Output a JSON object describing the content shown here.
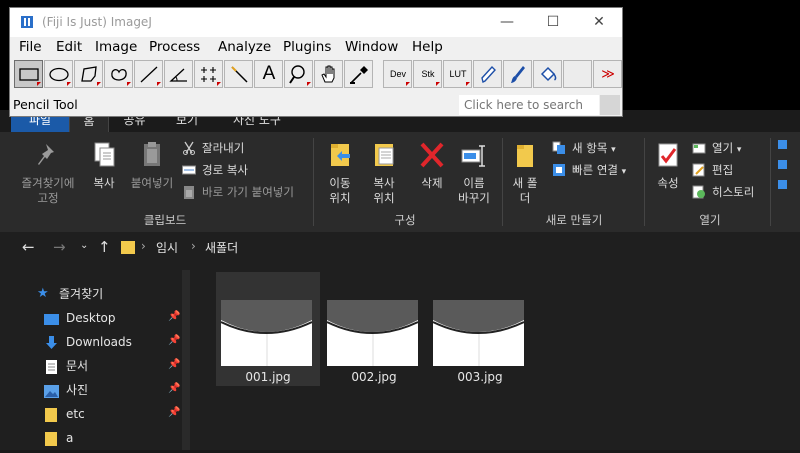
{
  "imagej": {
    "title": "(Fiji Is Just) ImageJ",
    "menu": [
      "File",
      "Edit",
      "Image",
      "Process",
      "Analyze",
      "Plugins",
      "Window",
      "Help"
    ],
    "tool_labels": {
      "dev": "Dev",
      "stk": "Stk",
      "lut": "LUT",
      "text": "A",
      "more": "≫"
    },
    "status": "Pencil Tool",
    "search_placeholder": "Click here to search"
  },
  "explorer": {
    "ribbon_tabs": [
      "파일",
      "홈",
      "공유",
      "보기",
      "사진 도구"
    ],
    "clipboard": {
      "pin": "즐겨찾기에 고정",
      "copy": "복사",
      "paste": "붙여넣기",
      "cut": "잘라내기",
      "copy_path": "경로 복사",
      "paste_shortcut": "바로 가기 붙여넣기",
      "label": "클립보드"
    },
    "organize": {
      "move_to": "이동 위치",
      "copy_to": "복사 위치",
      "delete": "삭제",
      "rename": "이름 바꾸기",
      "label": "구성"
    },
    "new": {
      "new_folder": "새 폴더",
      "new_item": "새 항목",
      "easy_access": "빠른 연결",
      "label": "새로 만들기"
    },
    "open": {
      "properties": "속성",
      "open": "열기",
      "edit": "편집",
      "history": "히스토리",
      "label": "열기"
    },
    "breadcrumb": [
      "임시",
      "새폴더"
    ],
    "nav": {
      "quick_access": "즐겨찾기",
      "items": [
        "Desktop",
        "Downloads",
        "문서",
        "사진",
        "etc",
        "a"
      ]
    },
    "files": [
      "001.jpg",
      "002.jpg",
      "003.jpg"
    ]
  },
  "colors": {
    "explorer_bg": "#1f1f1f",
    "ribbon_bg": "#2b2b2b",
    "file_tab": "#1b5aa8",
    "folder_yellow": "#f2c94c",
    "imagej_bg": "#f0f0f0"
  }
}
